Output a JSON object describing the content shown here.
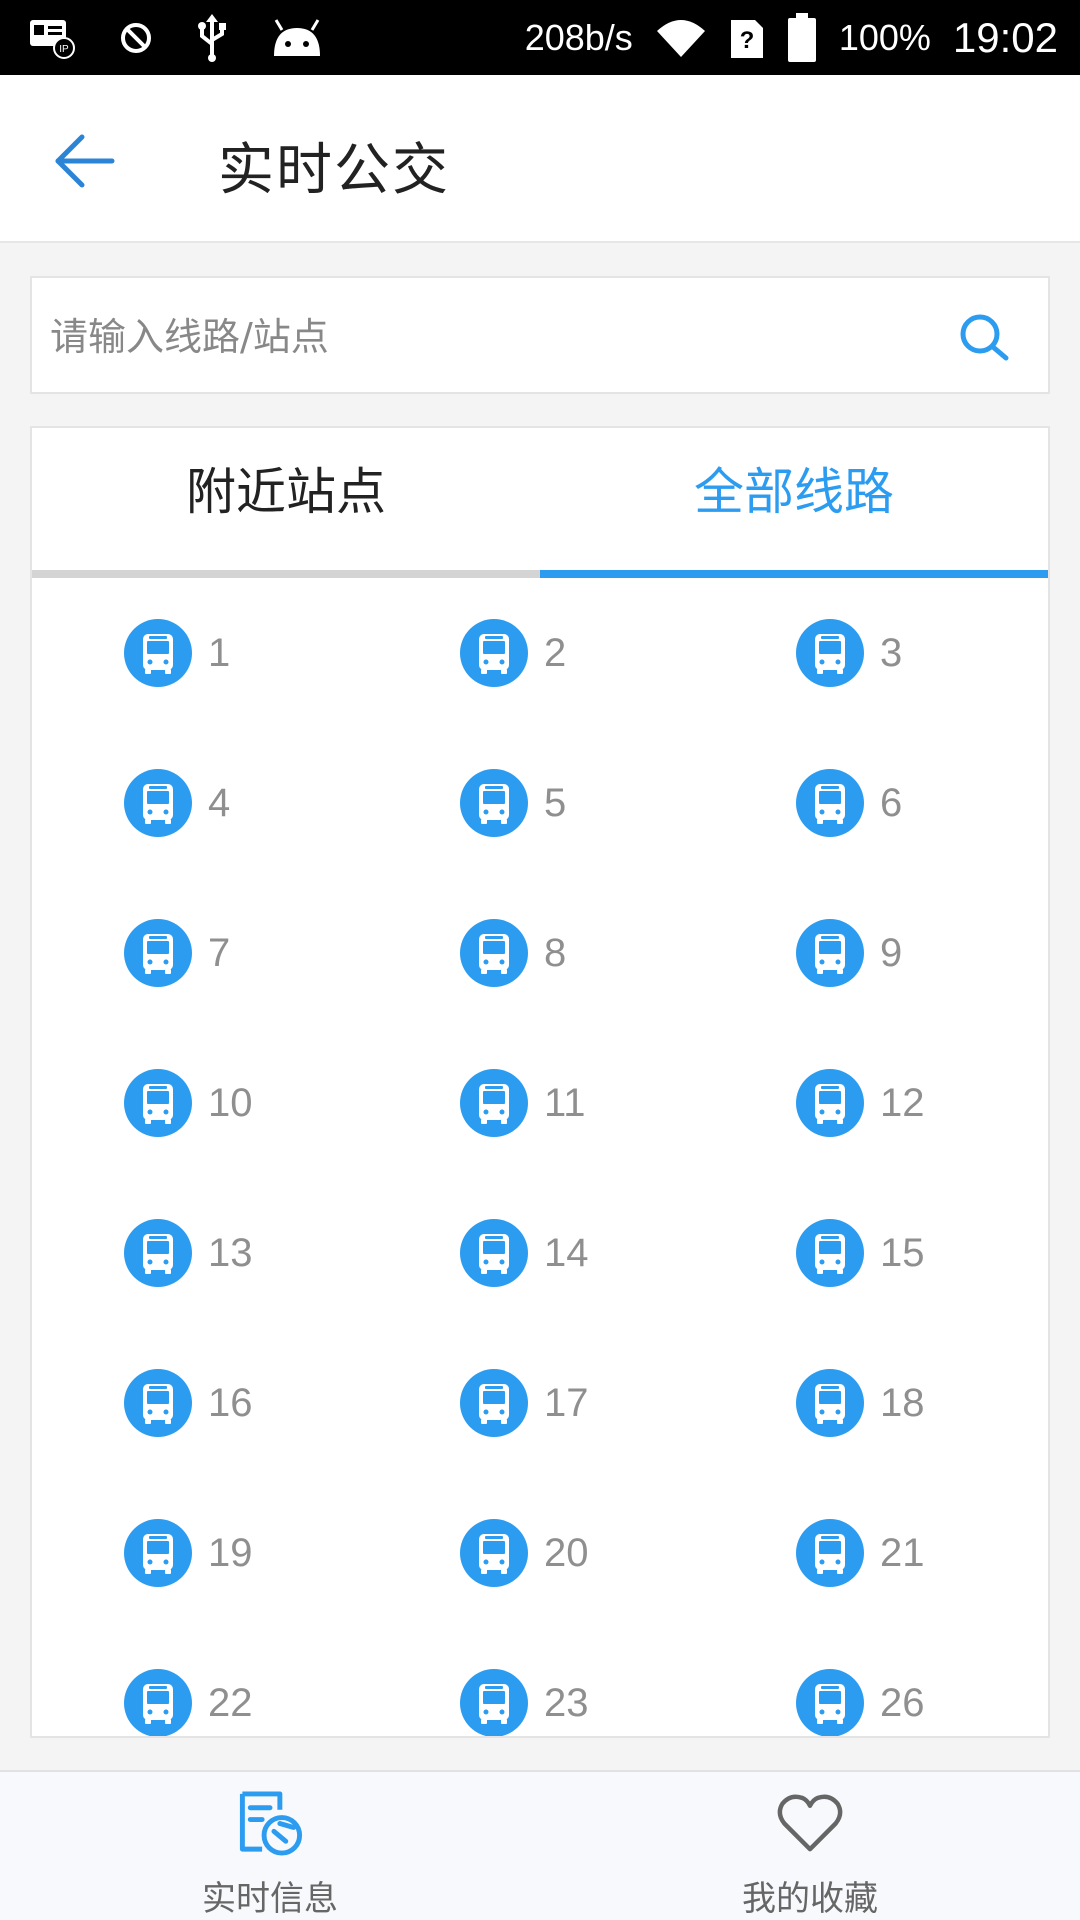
{
  "statusbar": {
    "net_speed": "208b/s",
    "battery": "100%",
    "time": "19:02"
  },
  "header": {
    "title": "实时公交"
  },
  "search": {
    "placeholder": "请输入线路/站点"
  },
  "tabs": [
    {
      "label": "附近站点",
      "active": false
    },
    {
      "label": "全部线路",
      "active": true
    }
  ],
  "routes": [
    "1",
    "2",
    "3",
    "4",
    "5",
    "6",
    "7",
    "8",
    "9",
    "10",
    "11",
    "12",
    "13",
    "14",
    "15",
    "16",
    "17",
    "18",
    "19",
    "20",
    "21",
    "22",
    "23",
    "26"
  ],
  "bottom_nav": [
    {
      "label": "实时信息",
      "icon": "realtime-info-icon",
      "active": true
    },
    {
      "label": "我的收藏",
      "icon": "heart-icon",
      "active": false
    }
  ],
  "colors": {
    "accent": "#2c9cf0",
    "route_text": "#8f8f8f"
  }
}
